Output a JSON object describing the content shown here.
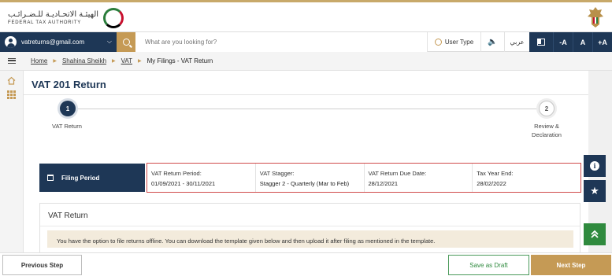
{
  "header": {
    "logo_ar": "الهيئـة الاتحـاديـة للـضـرائـب",
    "logo_en": "FEDERAL TAX AUTHORITY"
  },
  "toolbar": {
    "account_email": "vatreturns@gmail.com",
    "search_placeholder": "What are you looking for?",
    "user_type_label": "User Type",
    "arabic_label": "عربي",
    "font_decrease": "-A",
    "font_normal": "A",
    "font_increase": "+A"
  },
  "breadcrumb": {
    "items": [
      "Home",
      "Shahina Sheikh",
      "VAT",
      "My Filings - VAT Return"
    ]
  },
  "page": {
    "title": "VAT 201 Return"
  },
  "stepper": {
    "steps": [
      {
        "number": "1",
        "label": "VAT Return",
        "active": true
      },
      {
        "number": "2",
        "label_line1": "Review &",
        "label_line2": "Declaration",
        "active": false
      }
    ]
  },
  "filing_period": {
    "header_label": "Filing Period",
    "fields": [
      {
        "label": "VAT Return Period:",
        "value": "01/09/2021 - 30/11/2021"
      },
      {
        "label": "VAT Stagger:",
        "value": "Stagger 2 - Quarterly (Mar to Feb)"
      },
      {
        "label": "VAT Return Due Date:",
        "value": "28/12/2021"
      },
      {
        "label": "Tax Year End:",
        "value": "28/02/2022"
      }
    ]
  },
  "vat_section": {
    "title": "VAT Return",
    "notice": "You have the option to file returns offline. You can download the template given below and then upload it after filing as mentioned in the template."
  },
  "footer": {
    "previous_label": "Previous Step",
    "draft_label": "Save as Draft",
    "next_label": "Next Step"
  },
  "colors": {
    "navy": "#1e3756",
    "gold": "#c59a55",
    "green": "#2f8a3e",
    "highlight_red": "#d04b4b"
  },
  "icons": [
    "user-avatar-icon",
    "chevron-down-icon",
    "search-icon",
    "gear-icon",
    "speaker-icon",
    "contrast-icon",
    "menu-icon",
    "home-icon",
    "grid-icon",
    "calendar-icon",
    "info-icon",
    "star-icon",
    "double-chevron-up-icon"
  ]
}
